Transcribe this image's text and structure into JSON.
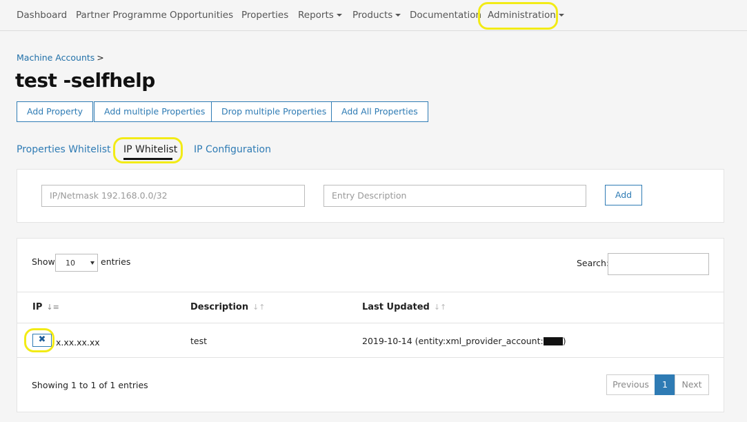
{
  "nav": {
    "items": [
      {
        "label": "Dashboard",
        "dropdown": false
      },
      {
        "label": "Partner Programme",
        "dropdown": false
      },
      {
        "label": "Opportunities",
        "dropdown": false
      },
      {
        "label": "Properties",
        "dropdown": false
      },
      {
        "label": "Reports",
        "dropdown": true
      },
      {
        "label": "Products",
        "dropdown": true
      },
      {
        "label": "Documentation",
        "dropdown": false
      },
      {
        "label": "Administration",
        "dropdown": true
      }
    ]
  },
  "breadcrumb": {
    "item": "Machine Accounts",
    "separator": ">"
  },
  "page_title": "test -selfhelp",
  "actions": {
    "add_property": "Add Property",
    "add_multiple": "Add multiple Properties",
    "drop_multiple": "Drop multiple Properties",
    "add_all": "Add All Properties"
  },
  "tabs": [
    {
      "label": "Properties Whitelist",
      "active": false
    },
    {
      "label": "IP Whitelist",
      "active": true
    },
    {
      "label": "IP Configuration",
      "active": false
    }
  ],
  "form": {
    "ip_placeholder": "IP/Netmask 192.168.0.0/32",
    "desc_placeholder": "Entry Description",
    "add_label": "Add"
  },
  "table": {
    "show_label": "Show",
    "page_size": "10",
    "entries_label": "entries",
    "search_label": "Search:",
    "columns": [
      "IP",
      "Description",
      "Last Updated"
    ],
    "rows": [
      {
        "ip": "x.xx.xx.xx",
        "description": "test",
        "updated_prefix": "2019-10-14 (entity:xml_provider_account:",
        "updated_suffix": ")"
      }
    ],
    "info": "Showing 1 to 1 of 1 entries",
    "pagination": {
      "previous": "Previous",
      "current": "1",
      "next": "Next"
    }
  },
  "icons": {
    "delete": "close-icon",
    "sort": "sort-icon"
  },
  "colors": {
    "accent": "#2e7bb4",
    "highlight": "#f2eb16"
  }
}
